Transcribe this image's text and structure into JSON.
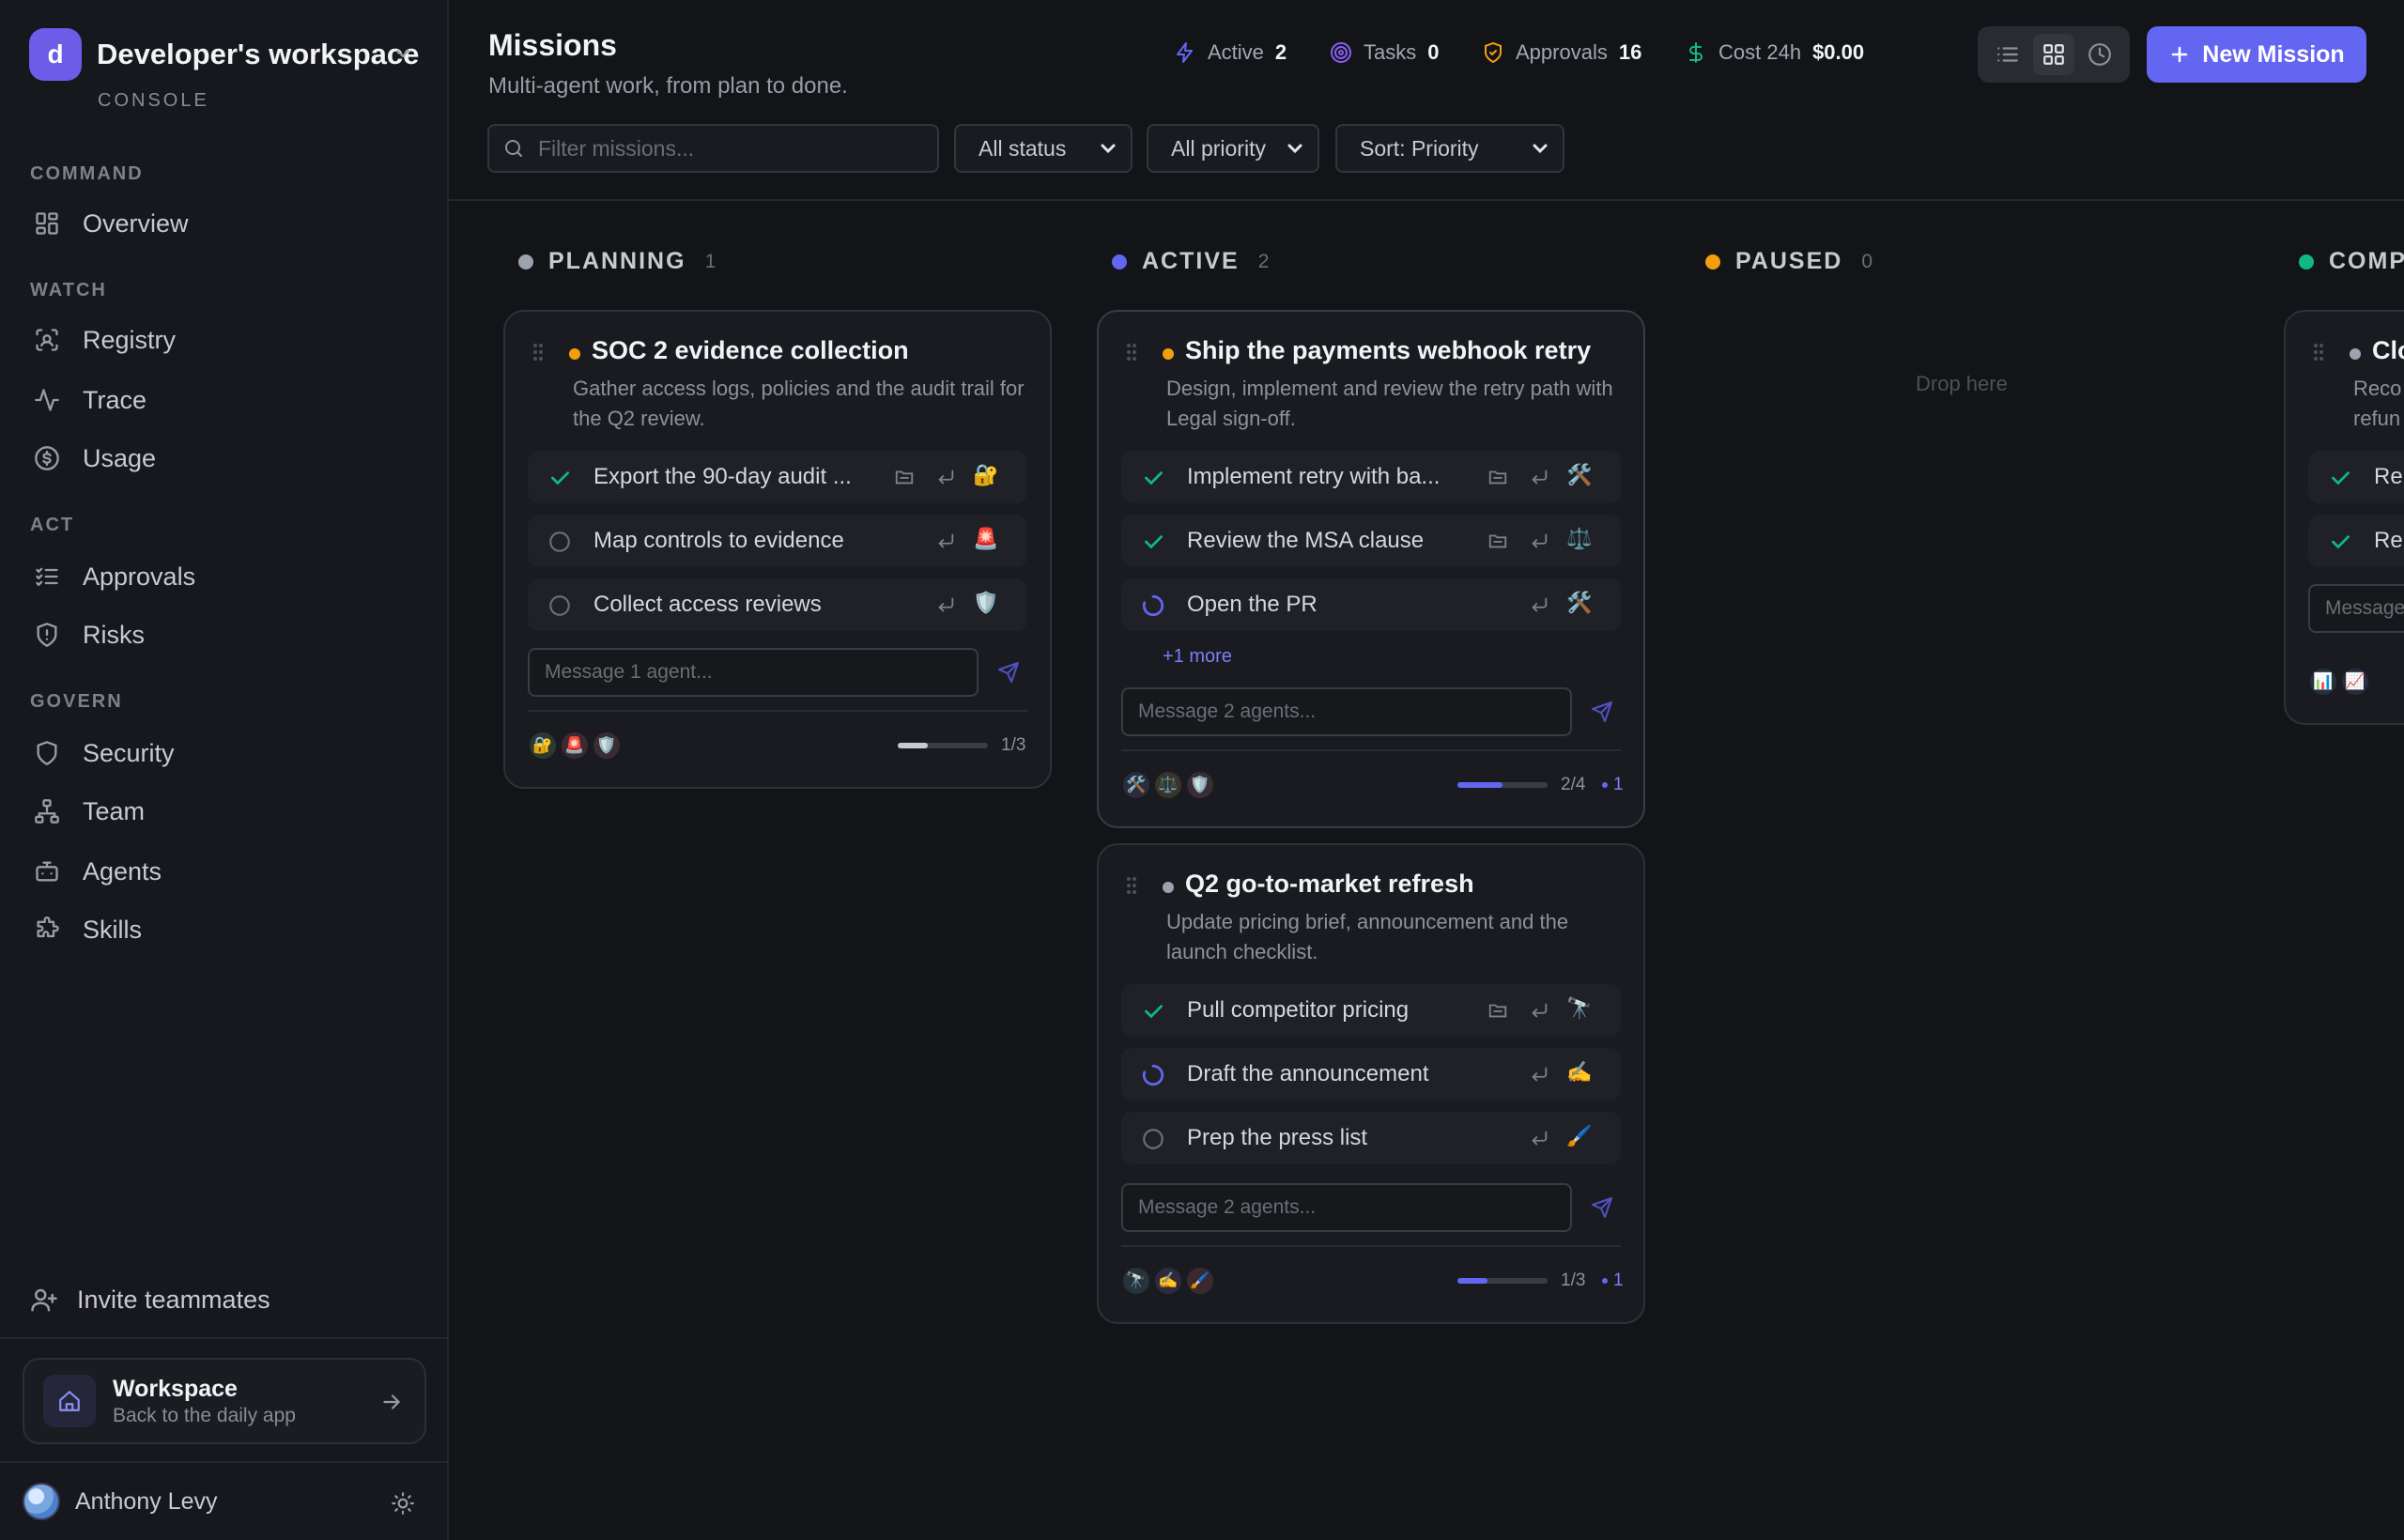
{
  "workspace": {
    "initial": "d",
    "name": "Developer's workspace",
    "subtitle": "CONSOLE"
  },
  "nav": {
    "sections": [
      {
        "label": "COMMAND",
        "items": [
          {
            "label": "Overview",
            "icon": "grid-icon"
          }
        ]
      },
      {
        "label": "WATCH",
        "items": [
          {
            "label": "Registry",
            "icon": "scan-icon"
          },
          {
            "label": "Trace",
            "icon": "activity-icon"
          },
          {
            "label": "Usage",
            "icon": "dollar-circle-icon"
          }
        ]
      },
      {
        "label": "ACT",
        "items": [
          {
            "label": "Approvals",
            "icon": "list-check-icon"
          },
          {
            "label": "Risks",
            "icon": "shield-alert-icon"
          }
        ]
      },
      {
        "label": "GOVERN",
        "items": [
          {
            "label": "Security",
            "icon": "shield-icon"
          },
          {
            "label": "Team",
            "icon": "org-chart-icon"
          },
          {
            "label": "Agents",
            "icon": "bot-icon"
          },
          {
            "label": "Skills",
            "icon": "puzzle-icon"
          }
        ]
      }
    ],
    "invite": "Invite teammates"
  },
  "workspace_card": {
    "title": "Workspace",
    "subtitle": "Back to the daily app"
  },
  "user": {
    "name": "Anthony Levy"
  },
  "header": {
    "title": "Missions",
    "subtitle": "Multi-agent work, from plan to done.",
    "stats": [
      {
        "label": "Active",
        "value": "2",
        "icon": "bolt-icon",
        "color": "#6366f1"
      },
      {
        "label": "Tasks",
        "value": "0",
        "icon": "target-icon",
        "color": "#8b5cf6"
      },
      {
        "label": "Approvals",
        "value": "16",
        "icon": "shield-check-icon",
        "color": "#f59e0b"
      },
      {
        "label": "Cost 24h",
        "value": "$0.00",
        "icon": "dollar-icon",
        "color": "#10b981"
      }
    ],
    "new_mission": "New Mission"
  },
  "filters": {
    "search_placeholder": "Filter missions...",
    "status": "All status",
    "priority": "All priority",
    "sort": "Sort: Priority"
  },
  "columns": [
    {
      "name": "PLANNING",
      "count": "1",
      "color": "#9ca3af"
    },
    {
      "name": "ACTIVE",
      "count": "2",
      "color": "#6366f1"
    },
    {
      "name": "PAUSED",
      "count": "0",
      "color": "#f59e0b",
      "empty": "Drop here"
    },
    {
      "name": "COMP",
      "count": "",
      "color": "#10b981"
    }
  ],
  "cards": {
    "soc2": {
      "title": "SOC 2 evidence collection",
      "priority_color": "#f59e0b",
      "description": "Gather access logs, policies and the audit trail for the Q2 review.",
      "tasks": [
        {
          "title": "Export the 90-day audit ...",
          "status": "done",
          "emoji": "🔐",
          "folder": true
        },
        {
          "title": "Map controls to evidence",
          "status": "todo",
          "emoji": "🚨",
          "folder": false
        },
        {
          "title": "Collect access reviews",
          "status": "todo",
          "emoji": "🛡️",
          "folder": false
        }
      ],
      "message_placeholder": "Message 1 agent...",
      "agents": [
        "🔐",
        "🚨",
        "🛡️"
      ],
      "progress": 0.33,
      "progress_text": "1/3"
    },
    "payments": {
      "title": "Ship the payments webhook retry",
      "priority_color": "#f59e0b",
      "description": "Design, implement and review the retry path with Legal sign-off.",
      "tasks": [
        {
          "title": "Implement retry with ba...",
          "status": "done",
          "emoji": "🛠️",
          "folder": true
        },
        {
          "title": "Review the MSA clause",
          "status": "done",
          "emoji": "⚖️",
          "folder": true
        },
        {
          "title": "Open the PR",
          "status": "running",
          "emoji": "🛠️",
          "folder": false
        }
      ],
      "more": "+1 more",
      "message_placeholder": "Message 2 agents...",
      "agents": [
        "🛠️",
        "⚖️",
        "🛡️"
      ],
      "progress": 0.5,
      "progress_text": "2/4",
      "unread": "1"
    },
    "gtm": {
      "title": "Q2 go-to-market refresh",
      "priority_color": "#9ca3af",
      "description": "Update pricing brief, announcement and the launch checklist.",
      "tasks": [
        {
          "title": "Pull competitor pricing",
          "status": "done",
          "emoji": "🔭",
          "folder": true
        },
        {
          "title": "Draft the announcement",
          "status": "running",
          "emoji": "✍️",
          "folder": false
        },
        {
          "title": "Prep the press list",
          "status": "todo",
          "emoji": "🖌️",
          "folder": false
        }
      ],
      "message_placeholder": "Message 2 agents...",
      "agents": [
        "🔭",
        "✍️",
        "🖌️"
      ],
      "progress": 0.33,
      "progress_text": "1/3",
      "unread": "1"
    },
    "partial": {
      "title": "Clo",
      "description_lines": [
        "Reco",
        "refun"
      ],
      "task_prefix": "Re",
      "message_placeholder": "Message",
      "agents": [
        "📊",
        "📈"
      ]
    }
  }
}
